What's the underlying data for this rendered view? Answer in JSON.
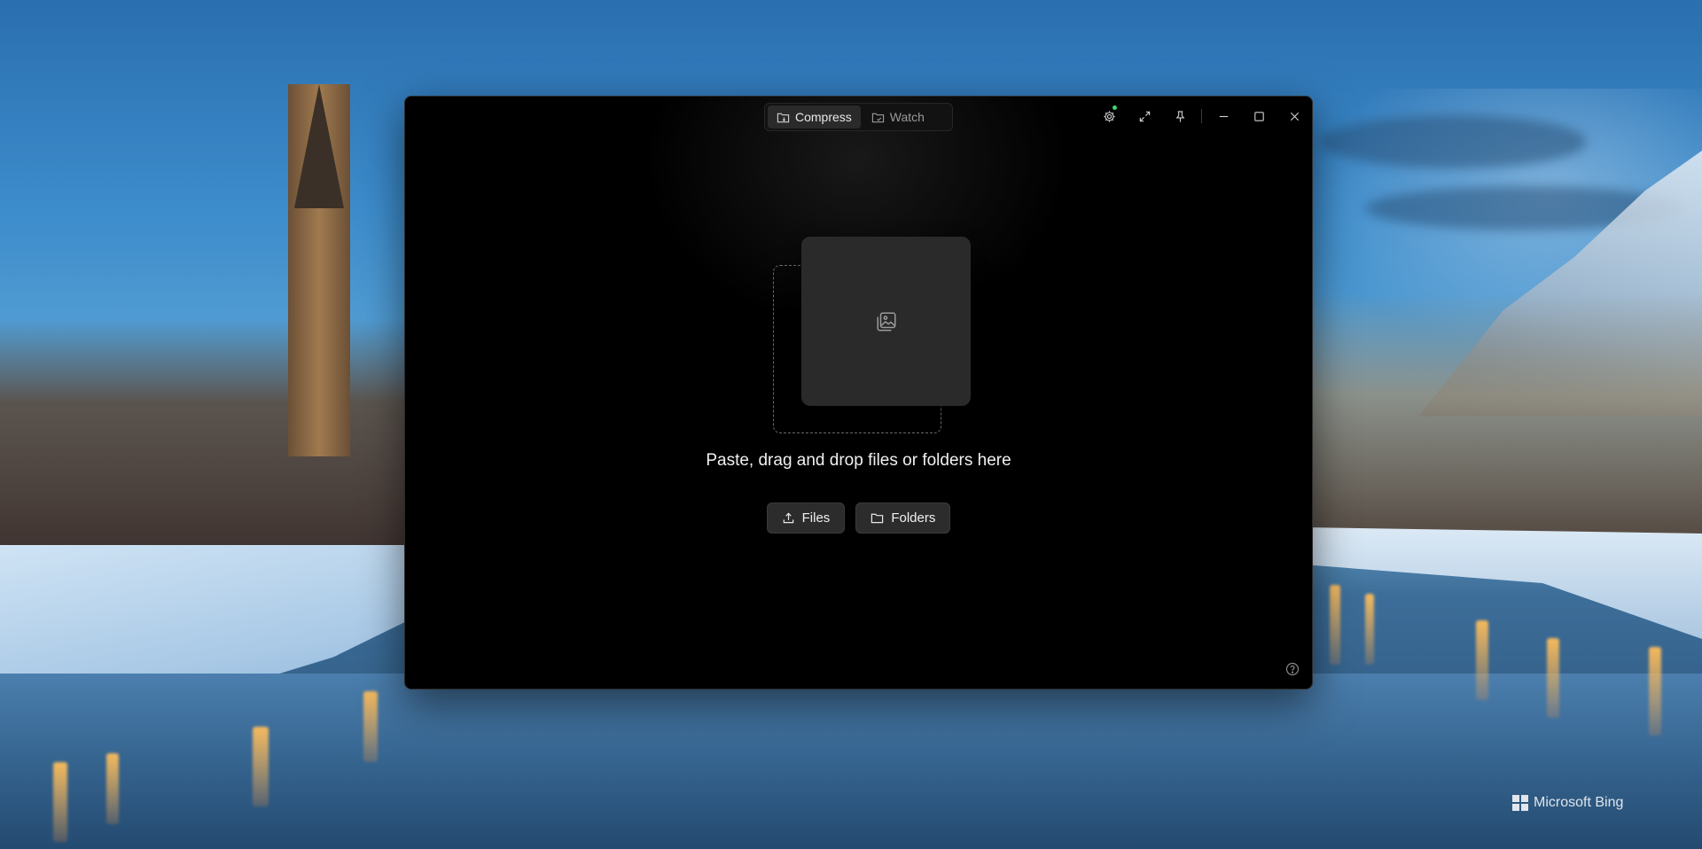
{
  "app": {
    "tabs": [
      {
        "label": "Compress",
        "icon": "folder-compress-icon",
        "active": true
      },
      {
        "label": "Watch",
        "icon": "folder-watch-icon",
        "active": false
      }
    ],
    "title_actions": [
      {
        "name": "settings-button",
        "icon": "gear-icon",
        "status": "online",
        "status_color": "#3fd46a"
      },
      {
        "name": "expand-button",
        "icon": "expand-icon"
      },
      {
        "name": "pin-button",
        "icon": "pin-icon"
      },
      {
        "name": "minimize-button",
        "icon": "minimize-icon"
      },
      {
        "name": "maximize-button",
        "icon": "maximize-icon"
      },
      {
        "name": "close-button",
        "icon": "close-icon"
      }
    ],
    "drop_zone": {
      "prompt": "Paste, drag and drop files or folders here",
      "illustration_icon": "image-stack-icon"
    },
    "actions": {
      "files_label": "Files",
      "folders_label": "Folders"
    },
    "help_icon": "help-icon",
    "colors": {
      "window_bg": "#000000",
      "button_bg": "#2c2c2c",
      "accent_status": "#3fd46a"
    }
  },
  "desktop": {
    "watermark": "Microsoft Bing"
  }
}
